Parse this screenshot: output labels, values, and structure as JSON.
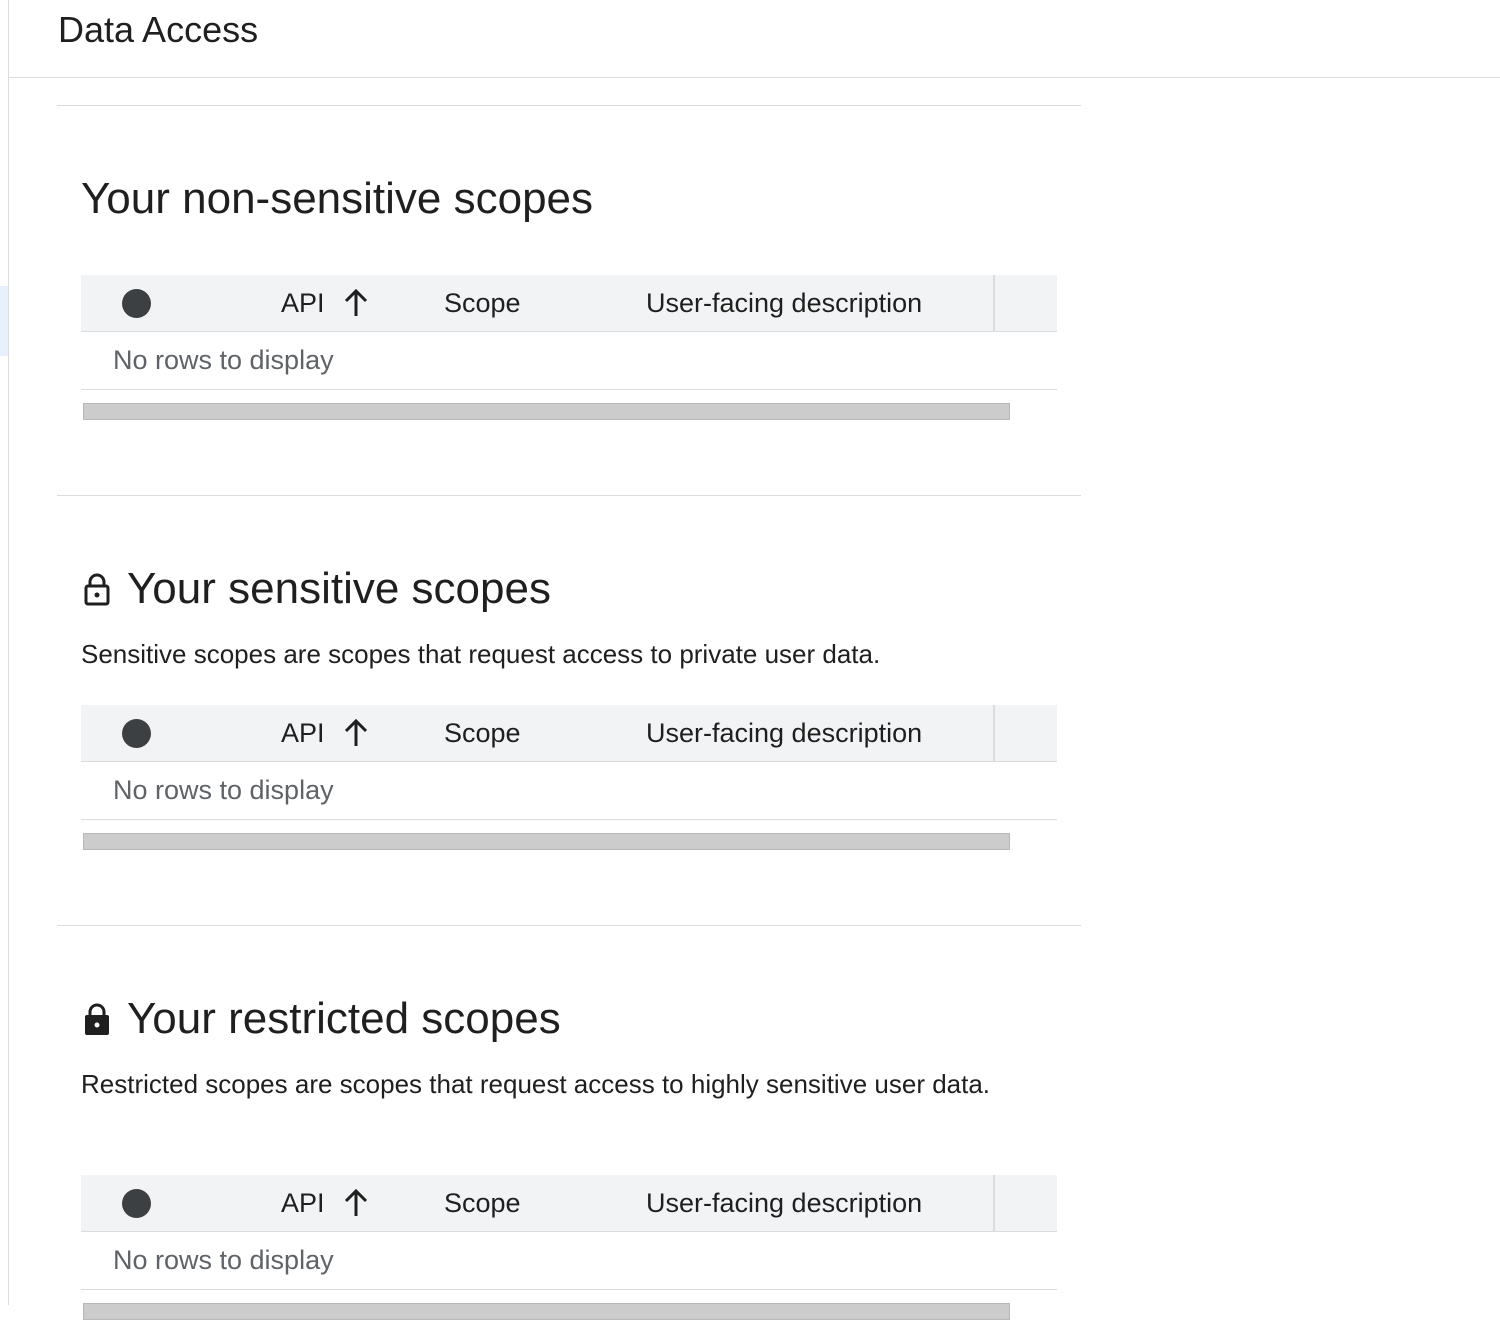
{
  "header": {
    "title": "Data Access"
  },
  "sections": [
    {
      "id": "non-sensitive",
      "heading": "Your non-sensitive scopes",
      "icon": null,
      "description": "",
      "table": {
        "columns": [
          "API",
          "Scope",
          "User-facing description"
        ],
        "sort_column": "API",
        "sort_direction": "ascending",
        "empty_message": "No rows to display"
      }
    },
    {
      "id": "sensitive",
      "heading": "Your sensitive scopes",
      "icon": "lock-outline-icon",
      "description": "Sensitive scopes are scopes that request access to private user data.",
      "table": {
        "columns": [
          "API",
          "Scope",
          "User-facing description"
        ],
        "sort_column": "API",
        "sort_direction": "ascending",
        "empty_message": "No rows to display"
      }
    },
    {
      "id": "restricted",
      "heading": "Your restricted scopes",
      "icon": "lock-filled-icon",
      "description": "Restricted scopes are scopes that request access to highly sensitive user data.",
      "table": {
        "columns": [
          "API",
          "Scope",
          "User-facing description"
        ],
        "sort_column": "API",
        "sort_direction": "ascending",
        "empty_message": "No rows to display"
      }
    }
  ],
  "colors": {
    "header_bg": "#f1f3f4",
    "divider": "#dadce0",
    "text_primary": "#1f1f1f",
    "text_secondary": "#5f6368"
  }
}
